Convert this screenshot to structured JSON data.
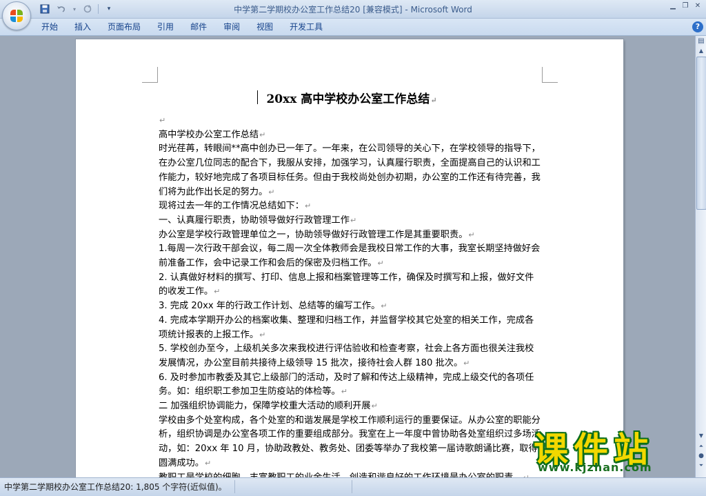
{
  "window": {
    "title": "中学第二学期校办公室工作总结20 [兼容模式]",
    "app_name": " - Microsoft Word"
  },
  "quick_access": {
    "save_icon": "save-icon",
    "undo_icon": "undo-icon",
    "redo_icon": "redo-icon",
    "customize_icon": "customize-icon"
  },
  "ribbon": {
    "tabs": [
      "开始",
      "插入",
      "页面布局",
      "引用",
      "邮件",
      "审阅",
      "视图",
      "开发工具"
    ]
  },
  "document": {
    "heading": "20xx 高中学校办公室工作总结",
    "paragraphs": [
      "",
      "高中学校办公室工作总结",
      "时光荏苒，转眼间**高中创办已一年了。一年来，在公司领导的关心下，在学校领导的指导下，在办公室几位同志的配合下，我服从安排，加强学习，认真履行职责，全面提高自己的认识和工作能力，较好地完成了各项目标任务。但由于我校尚处创办初期，办公室的工作还有待完善，我们将为此作出长足的努力。",
      "现将过去一年的工作情况总结如下：",
      "一、认真履行职责，协助领导做好行政管理工作",
      "办公室是学校行政管理单位之一，协助领导做好行政管理工作是其重要职责。",
      "1.每周一次行政干部会议，每二周一次全体教师会是我校日常工作的大事，我室长期坚持做好会前准备工作，会中记录工作和会后的保密及归档工作。",
      "2. 认真做好材料的撰写、打印、信息上报和档案管理等工作，确保及时撰写和上报，做好文件的收发工作。",
      "3. 完成 20xx 年的行政工作计划、总结等的编写工作。",
      "4. 完成本学期开办公的档案收集、整理和归档工作，并监督学校其它处室的相关工作，完成各项统计报表的上报工作。",
      "5. 学校创办至今，上级机关多次来我校进行评估验收和检查考察，社会上各方面也很关注我校发展情况，办公室目前共接待上级领导 15 批次，接待社会人群 180 批次。",
      "6. 及时参加市教委及其它上级部门的活动，及时了解和传达上级精神，完成上级交代的各项任务。如：组织职工参加卫生防疫站的体检等。",
      "二 加强组织协调能力，保障学校重大活动的顺利开展",
      "学校由多个处室构成，各个处室的和谐发展是学校工作顺利运行的重要保证。从办公室的职能分析，组织协调是办公室各项工作的重要组成部分。我室在上一年度中曾协助各处室组织过多场活动，如：20xx 年 10 月，协助政教处、教务处、团委等举办了我校第一届诗歌朗诵比赛，取得圆满成功。",
      "教职工是学校的细胞，丰富教职工的业余生活，创造和谐良好的工作环境是办公室的职责。"
    ]
  },
  "statusbar": {
    "text": "中学第二学期校办公室工作总结20: 1,805 个字符(近似值)。"
  },
  "watermark": {
    "big_text": "课件站",
    "url": "www.kjzhan.com"
  }
}
